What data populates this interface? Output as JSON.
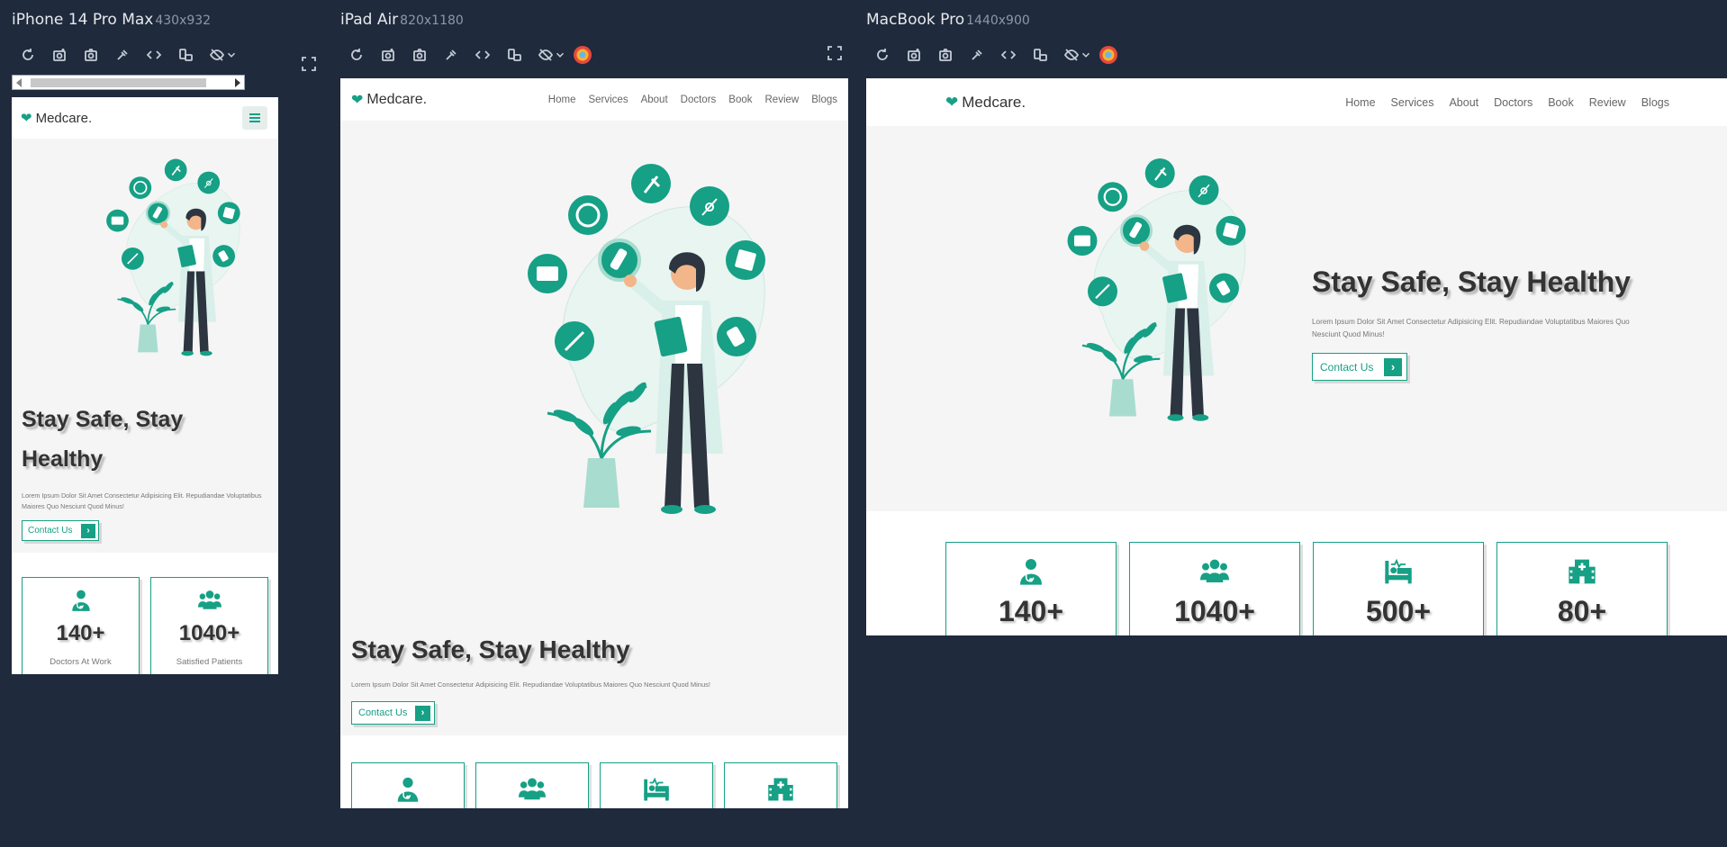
{
  "devices": [
    {
      "name": "iPhone 14 Pro Max",
      "res": "430x932"
    },
    {
      "name": "iPad Air",
      "res": "820x1180"
    },
    {
      "name": "MacBook Pro",
      "res": "1440x900"
    }
  ],
  "site": {
    "logo": "Medcare.",
    "nav": [
      "Home",
      "Services",
      "About",
      "Doctors",
      "Book",
      "Review",
      "Blogs"
    ],
    "hero_title": "Stay Safe, Stay Healthy",
    "hero_title_mobile_line1": "Stay Safe, Stay",
    "hero_title_mobile_line2": "Healthy",
    "hero_text": "Lorem Ipsum Dolor Sit Amet Consectetur Adipisicing Elit. Repudiandae Voluptatibus Maiores Quo Nesciunt Quod Minus!",
    "hero_text_line1": "Lorem Ipsum Dolor Sit Amet Consectetur Adipisicing Elit. Repudiandae Voluptatibus",
    "hero_text_line2": "Maiores Quo Nesciunt Quod Minus!",
    "mac_text_line1": "Lorem Ipsum Dolor Sit Amet Consectetur Adipisicing Elit. Repudiandae Voluptatibus Maiores Quo",
    "mac_text_line2": "Nesciunt Quod Minus!",
    "contact_label": "Contact Us",
    "stats": [
      {
        "num": "140+",
        "label": "Doctors At Work",
        "icon": "doctor-icon"
      },
      {
        "num": "1040+",
        "label": "Satisfied Patients",
        "icon": "users-icon"
      },
      {
        "num": "500+",
        "label": "",
        "icon": "bed-icon"
      },
      {
        "num": "80+",
        "label": "",
        "icon": "hospital-icon"
      }
    ]
  },
  "colors": {
    "brand": "#16a085",
    "dark": "#1f2a3c"
  }
}
